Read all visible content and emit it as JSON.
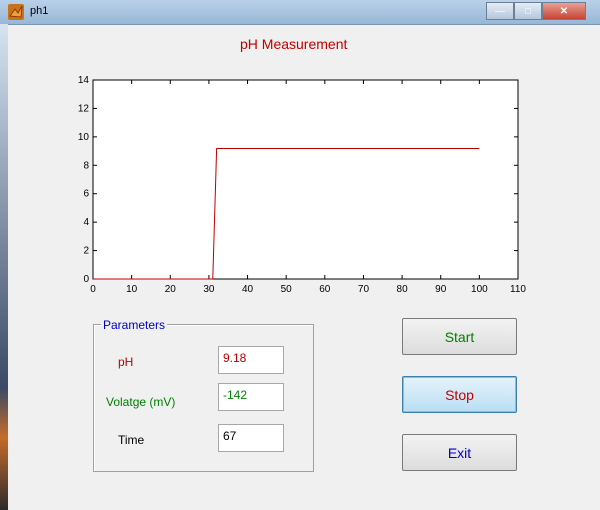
{
  "window": {
    "title": "ph1"
  },
  "plot": {
    "title": "pH Measurement",
    "y_ticks": [
      "0",
      "2",
      "4",
      "6",
      "8",
      "10",
      "12",
      "14"
    ],
    "x_ticks": [
      "0",
      "10",
      "20",
      "30",
      "40",
      "50",
      "60",
      "70",
      "80",
      "90",
      "100",
      "110"
    ]
  },
  "chart_data": {
    "type": "line",
    "title": "pH Measurement",
    "xlabel": "",
    "ylabel": "",
    "xlim": [
      0,
      110
    ],
    "ylim": [
      0,
      14
    ],
    "grid": false,
    "series": [
      {
        "x": [
          0,
          31,
          32,
          100
        ],
        "y": [
          0,
          0,
          9.18,
          9.18
        ]
      }
    ],
    "line_color": "#c00000"
  },
  "parameters": {
    "title": "Parameters",
    "ph_label": "pH",
    "ph_value": "9.18",
    "voltage_label": "Volatge (mV)",
    "voltage_value": "-142",
    "time_label": "Time",
    "time_value": "67"
  },
  "buttons": {
    "start": "Start",
    "stop": "Stop",
    "exit": "Exit"
  },
  "colors": {
    "ph": "#c00000",
    "voltage": "#008000",
    "start": "#008000",
    "stop": "#c00000",
    "exit": "#0000c8"
  }
}
